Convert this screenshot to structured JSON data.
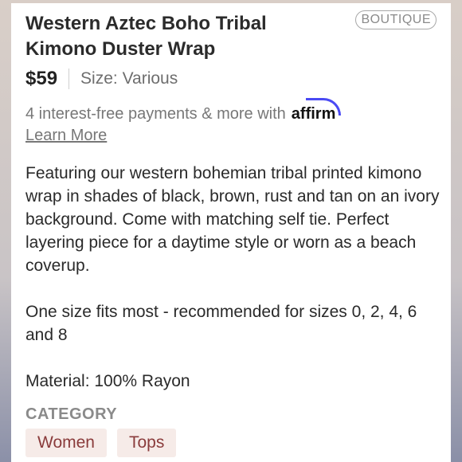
{
  "product": {
    "title_line1": "Western Aztec Boho Tribal",
    "title_line2": "Kimono Duster Wrap",
    "badge": "BOUTIQUE",
    "price": "$59",
    "size": "Size: Various"
  },
  "financing": {
    "text": "4 interest-free payments & more with",
    "brand": "affirm",
    "link": "Learn More"
  },
  "description": {
    "paragraph1": "Featuring our western bohemian tribal printed kimono wrap in shades of black, brown, rust and tan on an ivory background. Come with matching self tie. Perfect layering piece for a daytime style or worn as a beach coverup.",
    "paragraph2": "One size fits most - recommended for sizes 0, 2, 4, 6 and 8",
    "paragraph3": "Material: 100% Rayon"
  },
  "category": {
    "label": "CATEGORY",
    "tags": [
      "Women",
      "Tops"
    ]
  }
}
